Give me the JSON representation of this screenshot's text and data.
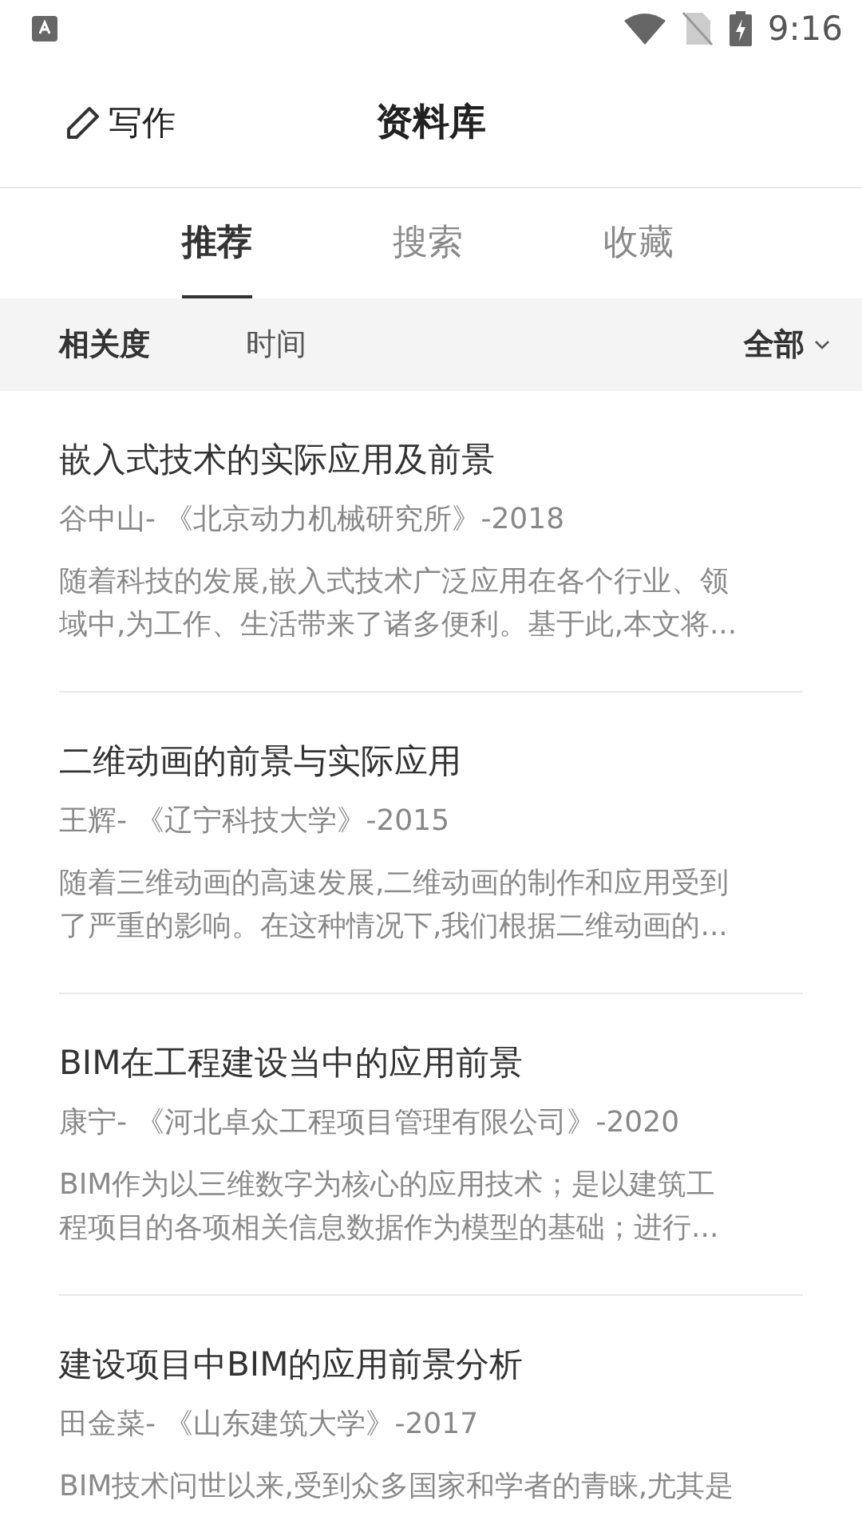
{
  "status_bar": {
    "time": "9:16"
  },
  "header": {
    "write_label": "写作",
    "title": "资料库"
  },
  "tabs": [
    {
      "label": "推荐",
      "selected": true
    },
    {
      "label": "搜索",
      "selected": false
    },
    {
      "label": "收藏",
      "selected": false
    }
  ],
  "sort_options": [
    {
      "label": "相关度",
      "selected": true
    },
    {
      "label": "时间",
      "selected": false
    }
  ],
  "filter": {
    "label": "全部"
  },
  "articles": [
    {
      "title": "嵌入式技术的实际应用及前景",
      "meta": "谷中山- 《北京动力机械研究所》-2018",
      "abstract_lines": [
        "随着科技的发展,嵌入式技术广泛应用在各个行业、领",
        "域中,为工作、生活带来了诸多便利。基于此,本文将..."
      ]
    },
    {
      "title": "二维动画的前景与实际应用",
      "meta": "王辉- 《辽宁科技大学》-2015",
      "abstract_lines": [
        "随着三维动画的高速发展,二维动画的制作和应用受到",
        "了严重的影响。在这种情况下,我们根据二维动画的..."
      ]
    },
    {
      "title": "BIM在工程建设当中的应用前景",
      "meta": "康宁- 《河北卓众工程项目管理有限公司》-2020",
      "abstract_lines": [
        "BIM作为以三维数字为核心的应用技术；是以建筑工",
        "程项目的各项相关信息数据作为模型的基础；进行..."
      ]
    },
    {
      "title": "建设项目中BIM的应用前景分析",
      "meta": "田金菜- 《山东建筑大学》-2017",
      "abstract_lines": [
        "BIM技术问世以来,受到众多国家和学者的青睐,尤其是"
      ]
    }
  ]
}
